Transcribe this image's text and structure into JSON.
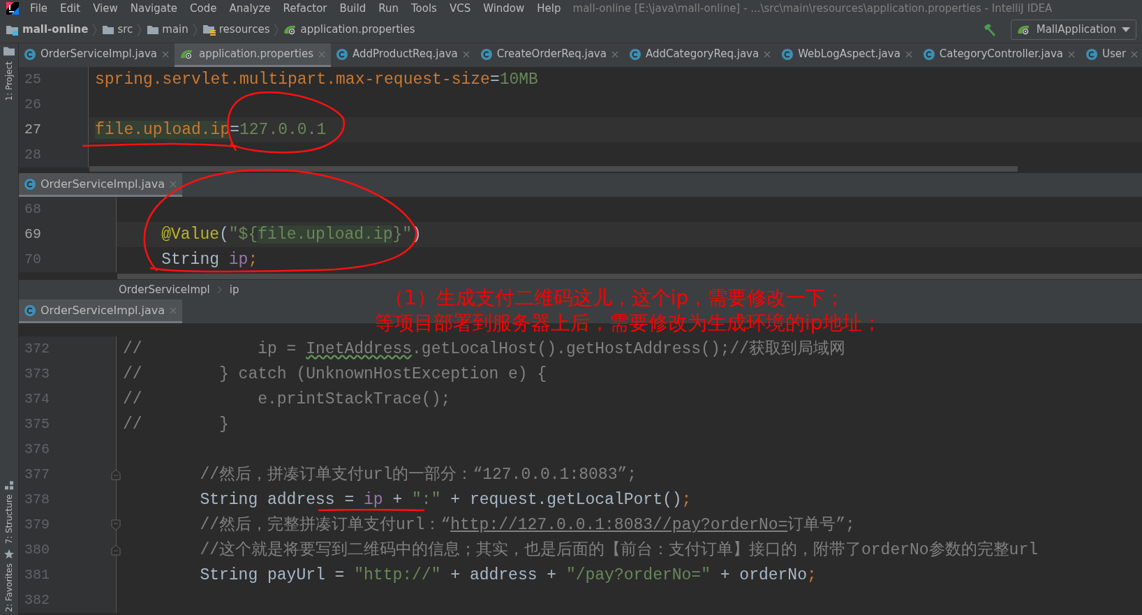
{
  "window": {
    "title": "mall-online [E:\\java\\mall-online] - ...\\src\\main\\resources\\application.properties - IntelliJ IDEA"
  },
  "menu": [
    "File",
    "Edit",
    "View",
    "Navigate",
    "Code",
    "Analyze",
    "Refactor",
    "Build",
    "Run",
    "Tools",
    "VCS",
    "Window",
    "Help"
  ],
  "breadcrumb": [
    {
      "label": "mall-online",
      "kind": "module"
    },
    {
      "label": "src",
      "kind": "folder"
    },
    {
      "label": "main",
      "kind": "folder"
    },
    {
      "label": "resources",
      "kind": "resources"
    },
    {
      "label": "application.properties",
      "kind": "properties"
    }
  ],
  "run_config": {
    "label": "MallApplication"
  },
  "tool_windows": [
    {
      "label": "1: Project",
      "kind": "folder"
    },
    {
      "label": "7: Structure",
      "kind": "structure"
    },
    {
      "label": "2: Favorites",
      "kind": "star"
    }
  ],
  "tabs": [
    {
      "label": "OrderServiceImpl.java",
      "kind": "class",
      "selected": false
    },
    {
      "label": "application.properties",
      "kind": "properties",
      "selected": true
    },
    {
      "label": "AddProductReq.java",
      "kind": "class",
      "selected": false
    },
    {
      "label": "CreateOrderReq.java",
      "kind": "class",
      "selected": false
    },
    {
      "label": "AddCategoryReq.java",
      "kind": "class",
      "selected": false
    },
    {
      "label": "WebLogAspect.java",
      "kind": "class",
      "selected": false
    },
    {
      "label": "CategoryController.java",
      "kind": "class",
      "selected": false
    },
    {
      "label": "User",
      "kind": "class",
      "selected": false
    }
  ],
  "editor": {
    "lines": [
      {
        "number": "25",
        "current": false,
        "tokens": [
          {
            "text": "spring.servlet.multipart.max-request-size",
            "kind": "key"
          },
          {
            "text": "=",
            "kind": "plain"
          },
          {
            "text": "10MB",
            "kind": "value"
          }
        ]
      },
      {
        "number": "26",
        "current": false
      },
      {
        "number": "27",
        "current": true,
        "tokens": [
          {
            "text": "file.upload.ip",
            "kind": "key_match"
          },
          {
            "text": "=",
            "kind": "plain"
          },
          {
            "text": "127.0.0.1",
            "kind": "value"
          }
        ]
      },
      {
        "number": "28",
        "current": false
      }
    ]
  },
  "splits": [
    {
      "tab": {
        "label": "OrderServiceImpl.java",
        "kind": "class",
        "selected": true
      },
      "lines": [
        {
          "number": "68",
          "current": false
        },
        {
          "number": "69",
          "current": true,
          "tokens": [
            {
              "text": "    @Value",
              "kind": "annotation"
            },
            {
              "text": "(",
              "kind": "plain"
            },
            {
              "text": "\"${",
              "kind": "string"
            },
            {
              "text": "file.upload.ip",
              "kind": "string_match"
            },
            {
              "text": "}\"",
              "kind": "string"
            },
            {
              "text": ")",
              "kind": "plain"
            }
          ]
        },
        {
          "number": "70",
          "current": false,
          "tokens": [
            {
              "text": "    String ",
              "kind": "plain"
            },
            {
              "text": "ip",
              "kind": "field"
            },
            {
              "text": ";",
              "kind": "key"
            }
          ]
        }
      ],
      "breadcrumb": [
        "OrderServiceImpl",
        "ip"
      ]
    },
    {
      "tab": {
        "label": "OrderServiceImpl.java",
        "kind": "class",
        "selected": true
      },
      "lines": [
        {
          "number": "372",
          "current": false,
          "tokens": [
            {
              "text": "//            ip = ",
              "kind": "comment"
            },
            {
              "text": "InetAddress",
              "kind": "comment_warn"
            },
            {
              "text": ".getLocalHost().getHostAddress();//获取到局域网",
              "kind": "comment"
            }
          ]
        },
        {
          "number": "373",
          "current": false,
          "tokens": [
            {
              "text": "//        } catch (UnknownHostException e) {",
              "kind": "comment"
            }
          ]
        },
        {
          "number": "374",
          "current": false,
          "tokens": [
            {
              "text": "//            e.printStackTrace();",
              "kind": "comment"
            }
          ]
        },
        {
          "number": "375",
          "current": false,
          "tokens": [
            {
              "text": "//        }",
              "kind": "comment"
            }
          ]
        },
        {
          "number": "376",
          "current": false
        },
        {
          "number": "377",
          "current": false,
          "kind": "fold_start",
          "tokens": [
            {
              "text": "        //然后，拼凑订单支付url的一部分：“127.0.0.1:8083”;",
              "kind": "comment"
            }
          ]
        },
        {
          "number": "378",
          "current": false,
          "tokens": [
            {
              "text": "        String address = ",
              "kind": "plain"
            },
            {
              "text": "ip",
              "kind": "field"
            },
            {
              "text": " + ",
              "kind": "plain"
            },
            {
              "text": "\":\"",
              "kind": "string"
            },
            {
              "text": " + request.getLocalPort()",
              "kind": "plain"
            },
            {
              "text": ";",
              "kind": "key"
            }
          ]
        },
        {
          "number": "379",
          "current": false,
          "kind": "fold_end",
          "tokens": [
            {
              "text": "        //然后，完整拼凑订单支付url：“",
              "kind": "comment"
            },
            {
              "text": "http://127.0.0.1:8083//pay?orderNo=",
              "kind": "comment_link"
            },
            {
              "text": "订单号”;",
              "kind": "comment"
            }
          ]
        },
        {
          "number": "380",
          "current": false,
          "kind": "fold_start",
          "tokens": [
            {
              "text": "        //这个就是将要写到二维码中的信息；其实，也是后面的【前台：支付订单】接口的，附带了orderNo参数的完整url",
              "kind": "comment"
            }
          ]
        },
        {
          "number": "381",
          "current": false,
          "tokens": [
            {
              "text": "        String payUrl = ",
              "kind": "plain"
            },
            {
              "text": "\"http://\"",
              "kind": "string"
            },
            {
              "text": " + address + ",
              "kind": "plain"
            },
            {
              "text": "\"/pay?orderNo=\"",
              "kind": "string"
            },
            {
              "text": " + orderNo",
              "kind": "plain"
            },
            {
              "text": ";",
              "kind": "key"
            }
          ]
        },
        {
          "number": "382",
          "current": false
        }
      ]
    }
  ],
  "annotation": {
    "lines": [
      "（1）生成支付二维码这儿，这个ip，需要修改一下；",
      "等项目部署到服务器上后，需要修改为生成环境的ip地址；"
    ]
  }
}
